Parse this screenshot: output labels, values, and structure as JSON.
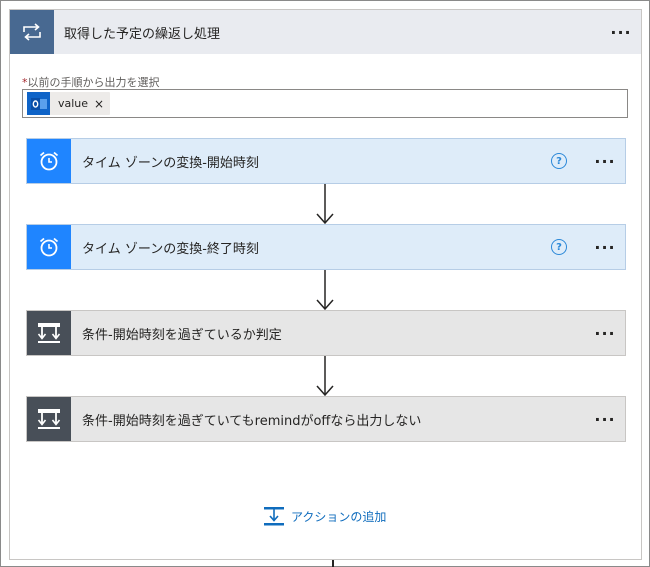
{
  "loop": {
    "title": "取得した予定の繰返し処理",
    "more": "···"
  },
  "selector": {
    "required_mark": "*",
    "label": "以前の手順から出力を選択",
    "token_value": "value",
    "token_remove": "×"
  },
  "steps": [
    {
      "title": "タイム ゾーンの変換-開始時刻",
      "kind": "timezone",
      "help": "?",
      "more": "···"
    },
    {
      "title": "タイム ゾーンの変換-終了時刻",
      "kind": "timezone",
      "help": "?",
      "more": "···"
    },
    {
      "title": "条件-開始時刻を過ぎているか判定",
      "kind": "condition",
      "more": "···"
    },
    {
      "title": "条件-開始時刻を過ぎていてもremindがoffなら出力しない",
      "kind": "condition",
      "more": "···"
    }
  ],
  "add_action": {
    "label": "アクションの追加"
  },
  "colors": {
    "loop_icon_bg": "#486991",
    "timezone_icon_bg": "#1f85ff",
    "condition_icon_bg": "#484f58",
    "link": "#0f6cbd"
  }
}
